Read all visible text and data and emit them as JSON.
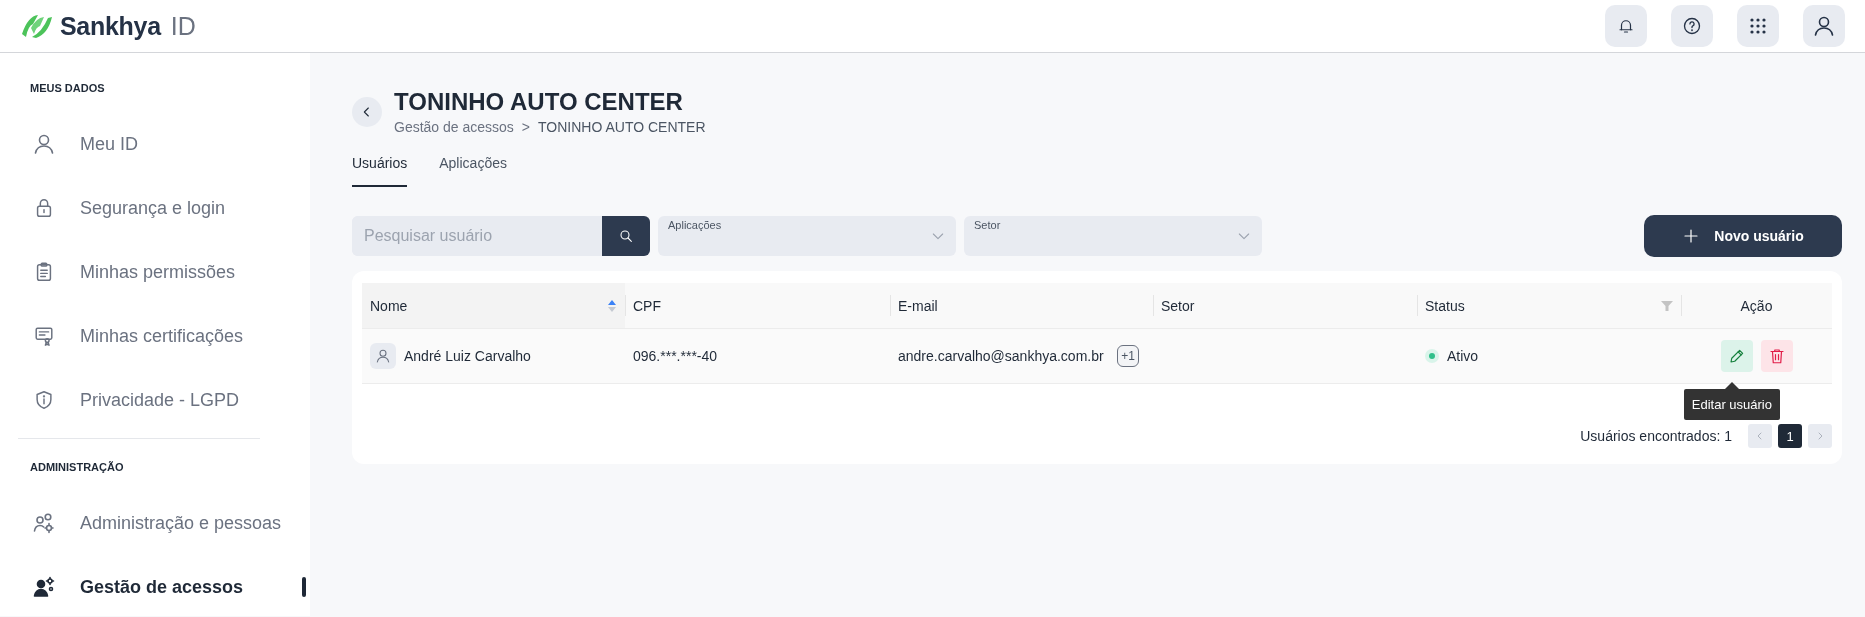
{
  "brand": {
    "name": "Sankhya",
    "suffix": "ID"
  },
  "sidebar": {
    "sections": [
      {
        "title": "MEUS DADOS",
        "items": [
          {
            "label": "Meu ID",
            "kind": "user",
            "selected": false
          },
          {
            "label": "Segurança e login",
            "kind": "lock",
            "selected": false
          },
          {
            "label": "Minhas permissões",
            "kind": "clipboard",
            "selected": false
          },
          {
            "label": "Minhas certificações",
            "kind": "certificate",
            "selected": false
          },
          {
            "label": "Privacidade - LGPD",
            "kind": "shield",
            "selected": false
          }
        ]
      },
      {
        "title": "ADMINISTRAÇÃO",
        "items": [
          {
            "label": "Administração e pessoas",
            "kind": "people",
            "selected": false
          },
          {
            "label": "Gestão de acessos",
            "kind": "access",
            "selected": true
          }
        ]
      }
    ]
  },
  "page": {
    "title": "TONINHO AUTO CENTER",
    "breadcrumb": [
      "Gestão de acessos",
      "TONINHO AUTO CENTER"
    ],
    "breadcrumb_separator": ">"
  },
  "tabs": [
    {
      "label": "Usuários",
      "selected": true
    },
    {
      "label": "Aplicações",
      "selected": false
    }
  ],
  "filters": {
    "search": {
      "placeholder": "Pesquisar usuário"
    },
    "dropdowns": [
      {
        "label": "Aplicações"
      },
      {
        "label": "Setor"
      }
    ]
  },
  "new_button": {
    "label": "Novo usuário"
  },
  "table": {
    "columns": [
      {
        "label": "Nome",
        "sortable": true,
        "filterable": false
      },
      {
        "label": "CPF",
        "sortable": false,
        "filterable": false
      },
      {
        "label": "E-mail",
        "sortable": false,
        "filterable": false
      },
      {
        "label": "Setor",
        "sortable": false,
        "filterable": false
      },
      {
        "label": "Status",
        "sortable": false,
        "filterable": true
      },
      {
        "label": "Ação",
        "sortable": false,
        "filterable": false
      }
    ],
    "rows": [
      {
        "name": "André Luiz Carvalho",
        "cpf": "096.***.***-40",
        "email": "andre.carvalho@sankhya.com.br",
        "email_extra": "+1",
        "status": "Ativo",
        "active": true
      }
    ]
  },
  "footer": {
    "count_text": "Usuários encontrados: 1",
    "pages": [
      {
        "label": "1",
        "selected": true
      }
    ]
  },
  "tooltip": {
    "text": "Editar usuário"
  }
}
